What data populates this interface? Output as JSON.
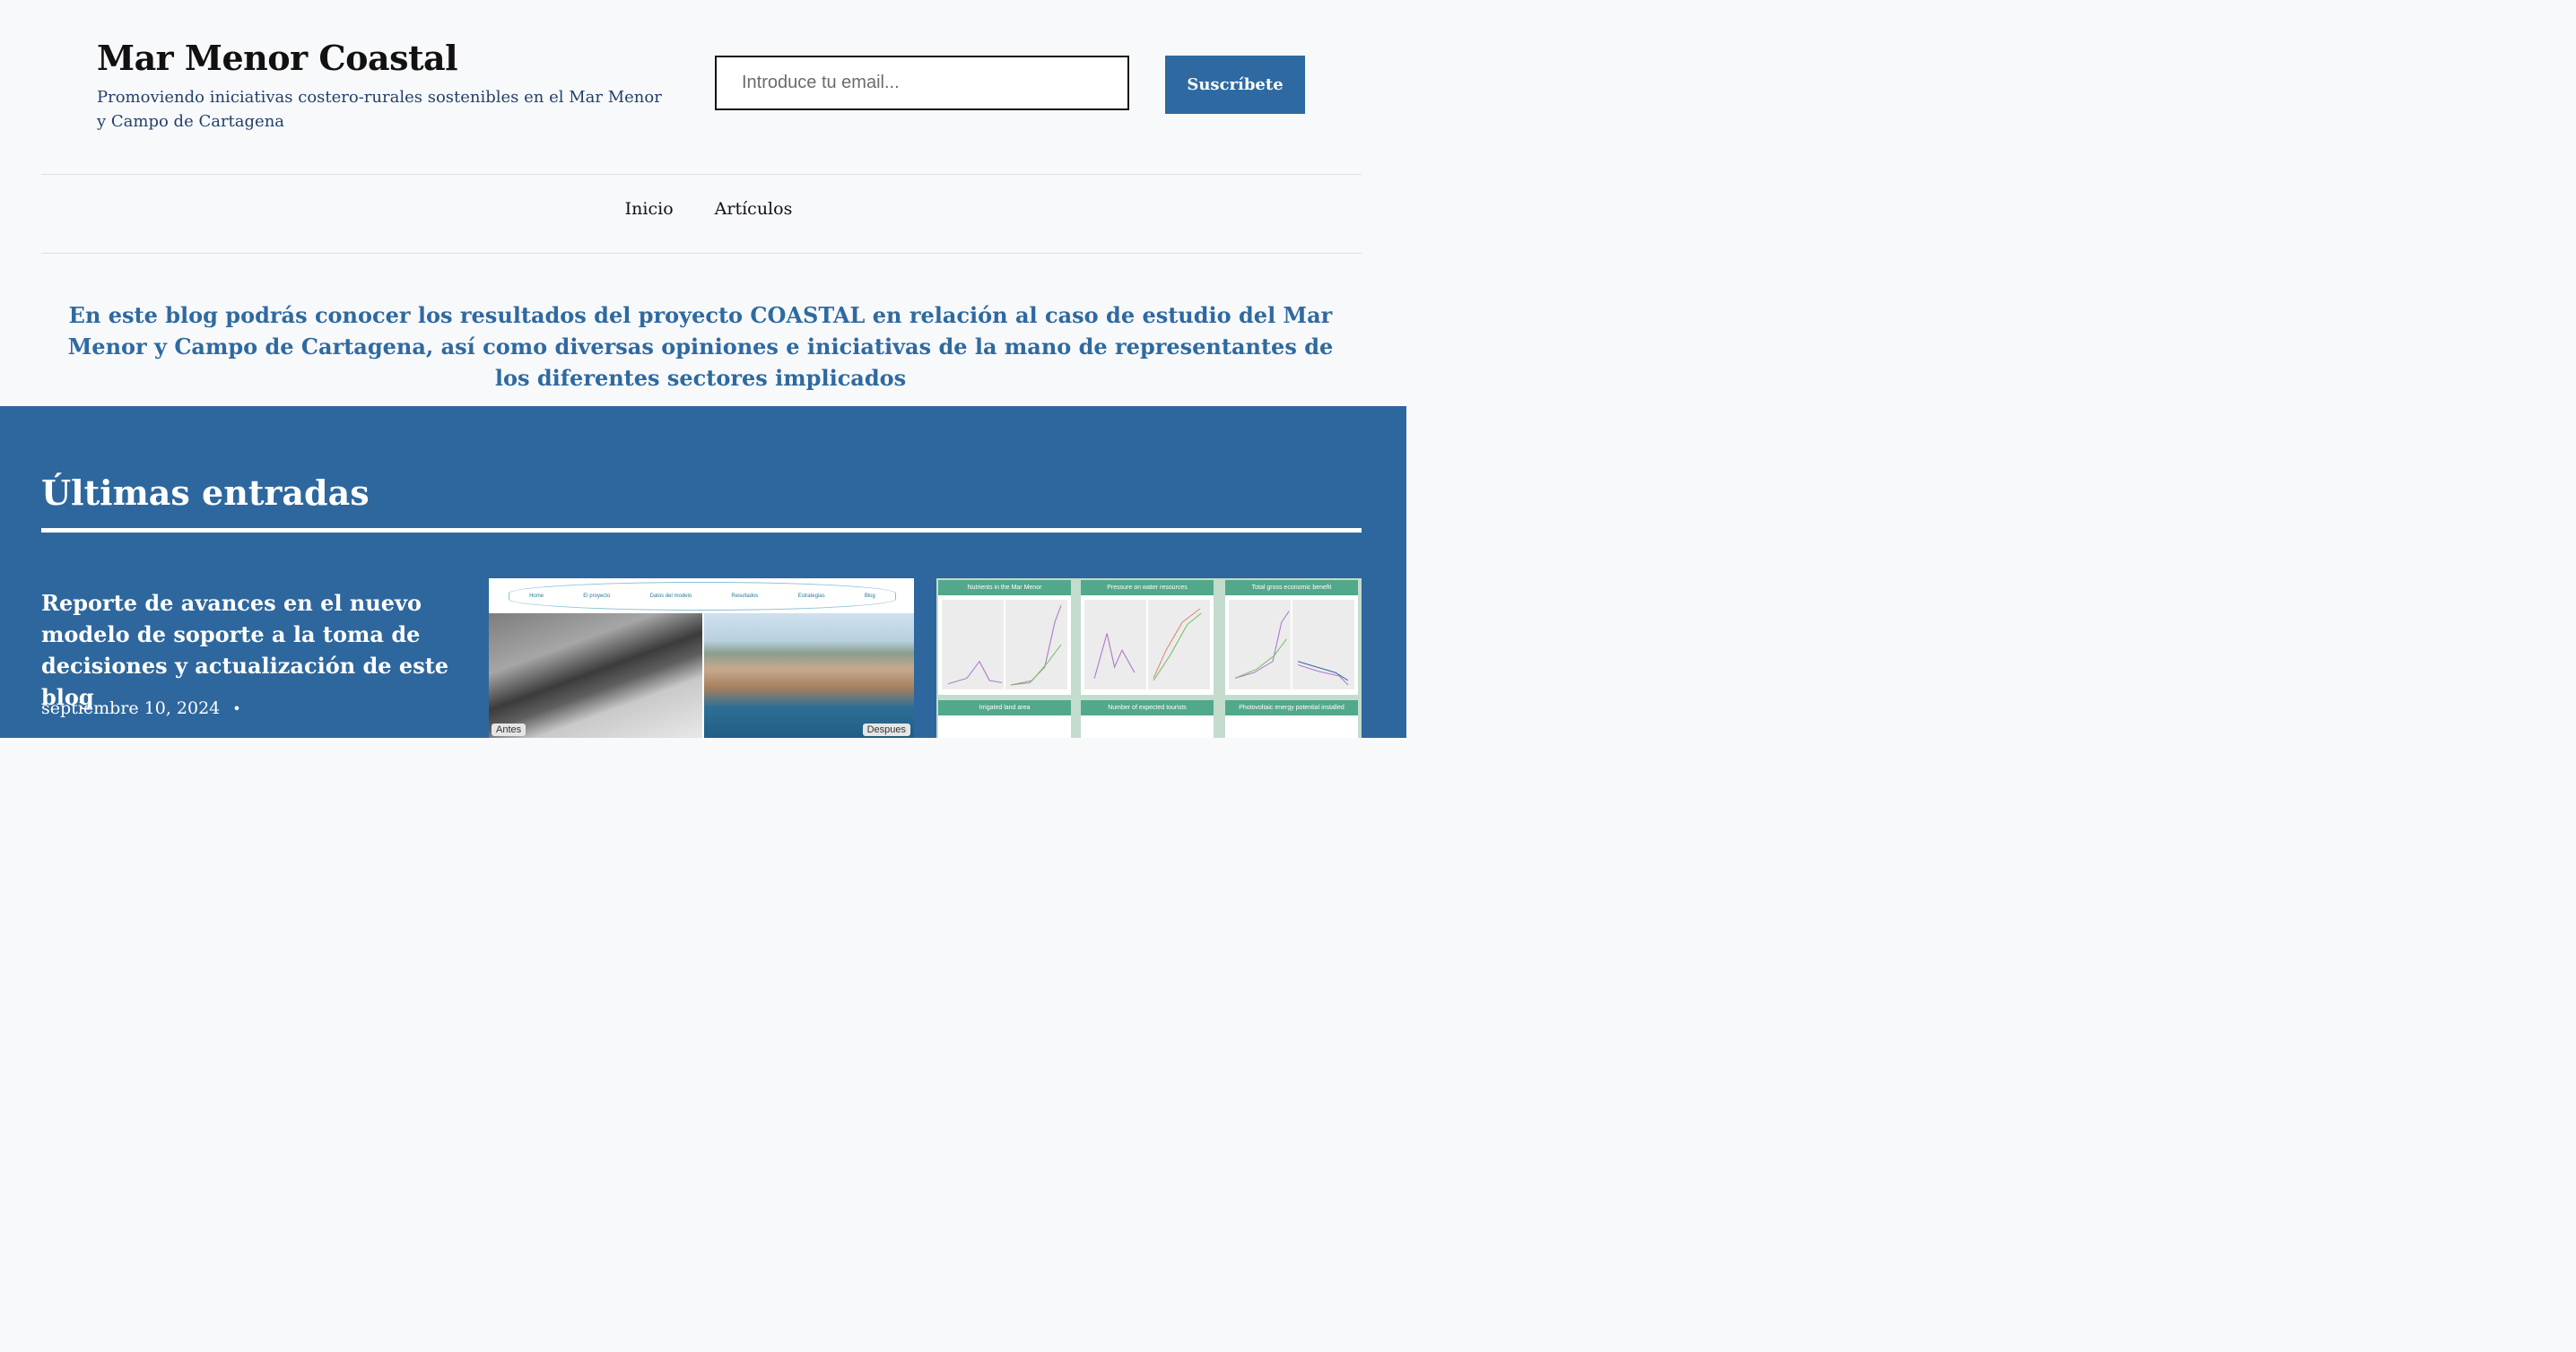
{
  "site": {
    "title": "Mar Menor Coastal",
    "tagline": "Promoviendo iniciativas costero-rurales sostenibles en el Mar Menor y Campo de Cartagena"
  },
  "subscribe": {
    "email_placeholder": "Introduce tu email...",
    "email_value": "",
    "button_label": "Suscríbete"
  },
  "nav": {
    "items": [
      {
        "label": "Inicio"
      },
      {
        "label": "Artículos"
      }
    ]
  },
  "intro": {
    "text": "En este blog podrás conocer los resultados del proyecto COASTAL en relación al caso de estudio del Mar Menor y Campo de Cartagena, así como diversas opiniones e iniciativas de la mano de representantes de los diferentes sectores implicados"
  },
  "latest": {
    "heading": "Últimas entradas",
    "post": {
      "title": "Reporte de avances en el nuevo modelo de soporte a la toma de decisiones y actualización de este blog",
      "date": "septiembre 10, 2024",
      "separator": "•"
    },
    "thumb1": {
      "nav_items": [
        "Home",
        "El proyecto",
        "Datos del modelo",
        "Resultados",
        "Estrategias",
        "Blog"
      ],
      "label_before": "Antes",
      "label_after": "Despues"
    },
    "thumb2": {
      "panels": [
        "Nutrients in the Mar Menor",
        "Pressure on water resources",
        "Total gross economic benefit",
        "Irrigated land area",
        "Number of expected tourists",
        "Photovoltaic energy potential installed"
      ]
    }
  },
  "colors": {
    "accent": "#2e6aa1",
    "section_bg": "#2e679d",
    "panel_header": "#52a88a"
  }
}
